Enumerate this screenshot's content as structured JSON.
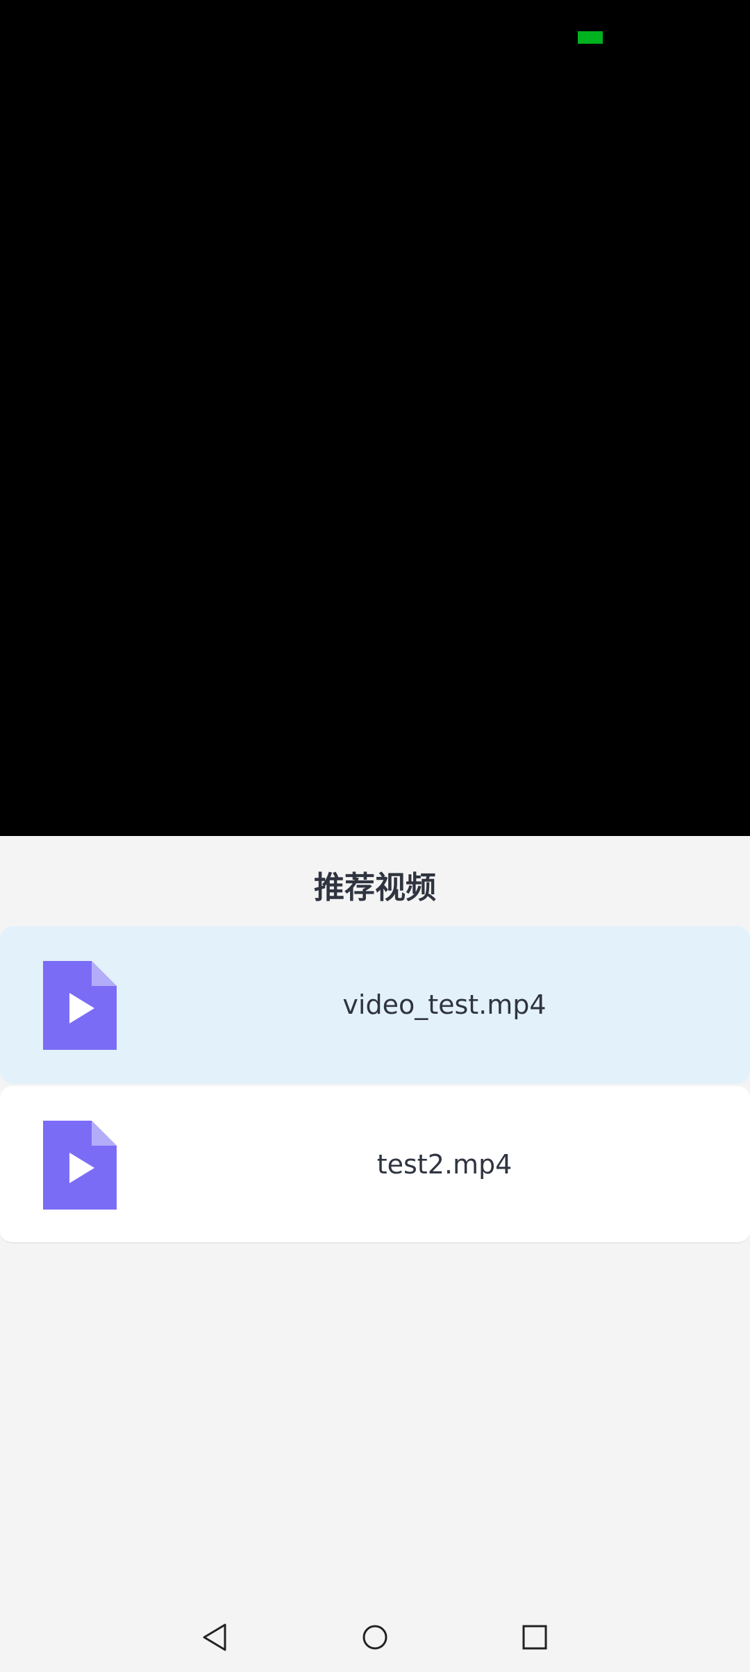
{
  "page": {
    "section_title": "推荐视频"
  },
  "colors": {
    "video_background": "#000000",
    "indicator": "#00b21f",
    "selected_item_bg": "#e3f1fb",
    "icon_purple": "#7b6cf6"
  },
  "videos": [
    {
      "label": "video_test.mp4",
      "icon": "video-file-icon",
      "selected": true
    },
    {
      "label": "test2.mp4",
      "icon": "video-file-icon",
      "selected": false
    }
  ],
  "nav": {
    "back_icon": "triangle-back-icon",
    "home_icon": "circle-home-icon",
    "recents_icon": "square-recents-icon"
  }
}
